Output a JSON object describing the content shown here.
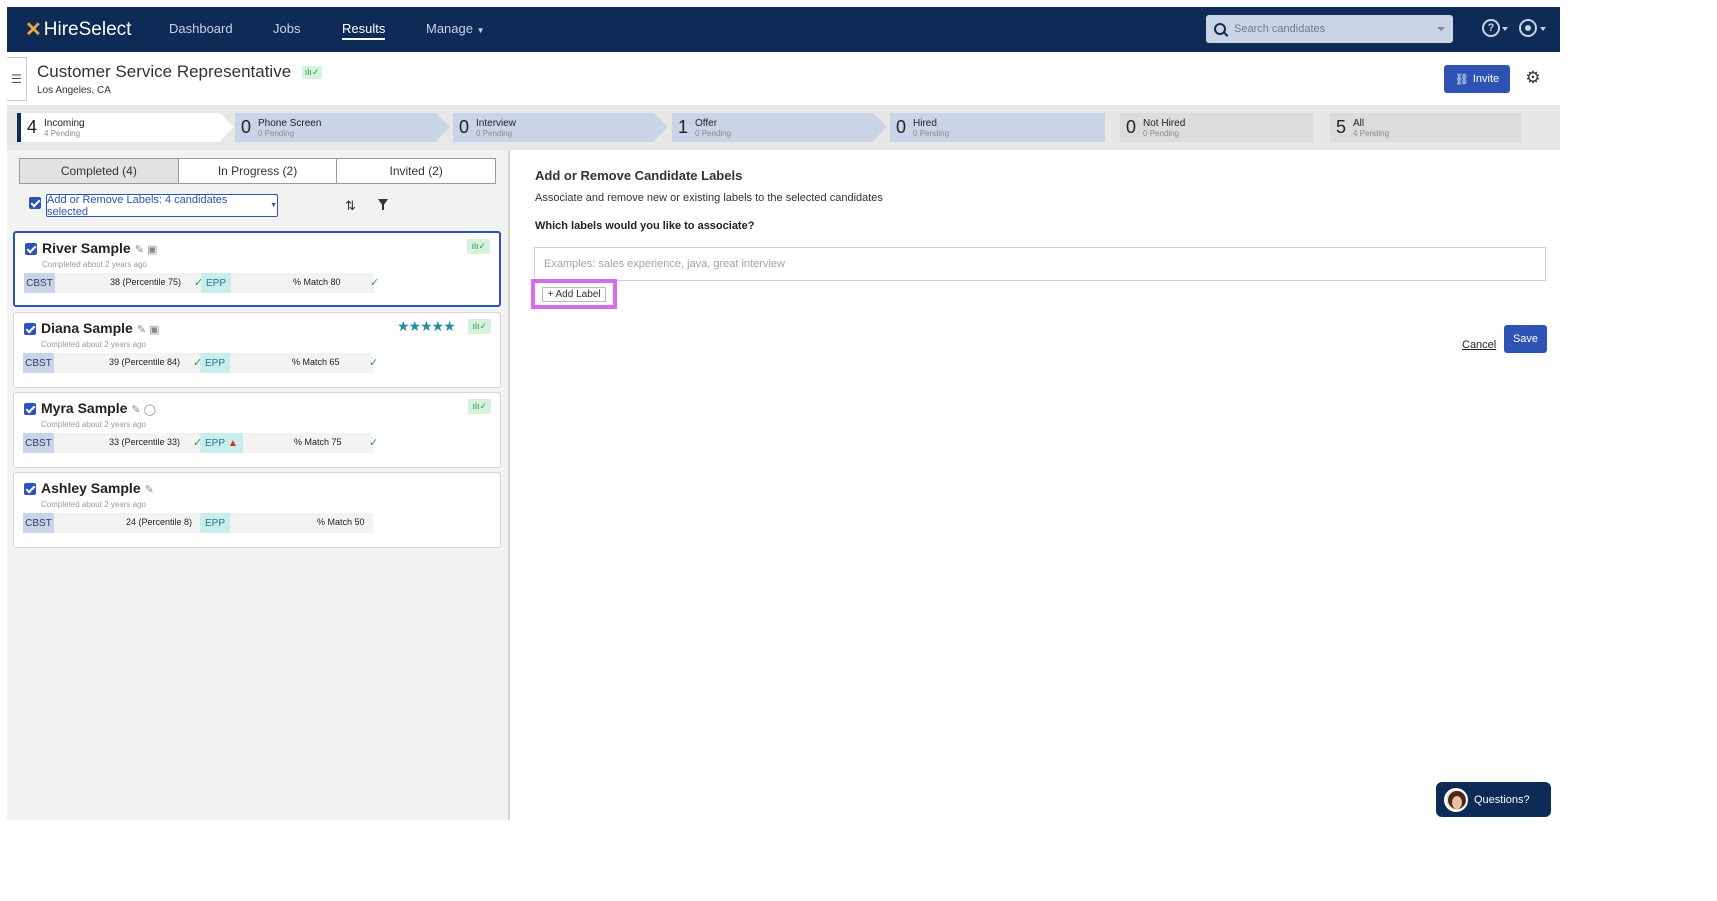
{
  "nav": {
    "logo": "HireSelect",
    "links": [
      {
        "label": "Dashboard",
        "active": false
      },
      {
        "label": "Jobs",
        "active": false
      },
      {
        "label": "Results",
        "active": true
      },
      {
        "label": "Manage",
        "active": false
      }
    ],
    "search_placeholder": "Search candidates",
    "help_icon": "question-circle-icon",
    "account_icon": "user-circle-icon"
  },
  "job": {
    "title": "Customer Service Representative",
    "location": "Los Angeles, CA",
    "invite_label": "Invite",
    "status_badge": "ılı✓"
  },
  "stages": [
    {
      "count": "4",
      "label": "Incoming",
      "sub": "4 Pending"
    },
    {
      "count": "0",
      "label": "Phone Screen",
      "sub": "0 Pending"
    },
    {
      "count": "0",
      "label": "Interview",
      "sub": "0 Pending"
    },
    {
      "count": "1",
      "label": "Offer",
      "sub": "0 Pending"
    },
    {
      "count": "0",
      "label": "Hired",
      "sub": "0 Pending"
    },
    {
      "count": "0",
      "label": "Not Hired",
      "sub": "0 Pending"
    },
    {
      "count": "5",
      "label": "All",
      "sub": "4 Pending"
    }
  ],
  "tabs": [
    {
      "label": "Completed (4)",
      "active": true
    },
    {
      "label": "In Progress (2)",
      "active": false
    },
    {
      "label": "Invited (2)",
      "active": false
    }
  ],
  "bulk": {
    "button_label": "Add or Remove Labels: 4 candidates selected"
  },
  "candidates": [
    {
      "name": "River Sample",
      "icons": "✎ ▣",
      "completed": "Completed about 2 years ago",
      "cbst": "CBST",
      "score": "38 (Percentile 75)",
      "epp": "EPP",
      "match": "% Match 80",
      "stars": "",
      "badge": "ılı✓",
      "warning": false
    },
    {
      "name": "Diana Sample",
      "icons": "✎ ▣",
      "completed": "Completed about 2 years ago",
      "cbst": "CBST",
      "score": "39 (Percentile 84)",
      "epp": "EPP",
      "match": "% Match 65",
      "stars": "★★★★★",
      "badge": "ılı✓",
      "warning": false
    },
    {
      "name": "Myra Sample",
      "icons": "✎ ◯",
      "completed": "Completed about 2 years ago",
      "cbst": "CBST",
      "score": "33 (Percentile 33)",
      "epp": "EPP",
      "match": "% Match 75",
      "stars": "",
      "badge": "ılı✓",
      "warning": true
    },
    {
      "name": "Ashley Sample",
      "icons": "✎",
      "completed": "Completed about 2 years ago",
      "cbst": "CBST",
      "score": "24 (Percentile 8)",
      "epp": "EPP",
      "match": "% Match 50",
      "stars": "",
      "badge": "",
      "warning": false
    }
  ],
  "labels_panel": {
    "title": "Add or Remove Candidate Labels",
    "subtitle": "Associate and remove new or existing labels to the selected candidates",
    "question": "Which labels would you like to associate?",
    "input_placeholder": "Examples: sales experience, java, great interview",
    "add_label": "+ Add Label",
    "cancel": "Cancel",
    "save": "Save"
  },
  "help_widget": {
    "label": "Questions?"
  },
  "colors": {
    "navy": "#0e2a56",
    "primary": "#2f53b4",
    "highlight": "#d46bf0",
    "success": "#2a9a4a"
  }
}
